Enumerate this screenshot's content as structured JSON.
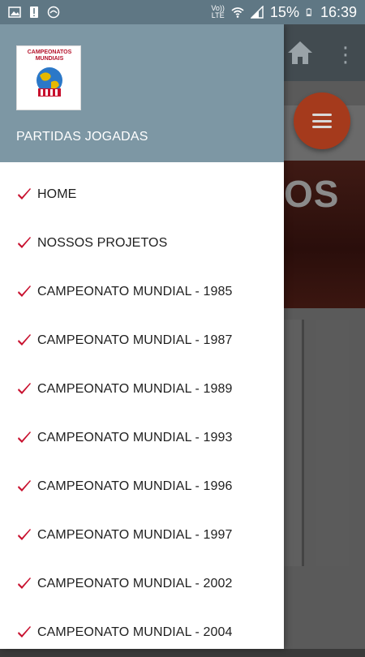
{
  "status_bar": {
    "network_label_top": "Vo))",
    "network_label_bottom": "LTE",
    "battery_percent": "15%",
    "time": "16:39"
  },
  "background_app": {
    "banner_text": "OS"
  },
  "drawer": {
    "logo": {
      "title_line1": "CAMPEONATOS",
      "title_line2": "MUNDIAIS"
    },
    "header_title": "PARTIDAS JOGADAS",
    "items": [
      {
        "label": "HOME"
      },
      {
        "label": "NOSSOS PROJETOS"
      },
      {
        "label": "CAMPEONATO MUNDIAL - 1985"
      },
      {
        "label": "CAMPEONATO MUNDIAL - 1987"
      },
      {
        "label": "CAMPEONATO MUNDIAL - 1989"
      },
      {
        "label": "CAMPEONATO MUNDIAL - 1993"
      },
      {
        "label": "CAMPEONATO MUNDIAL - 1996"
      },
      {
        "label": "CAMPEONATO MUNDIAL - 1997"
      },
      {
        "label": "CAMPEONATO MUNDIAL - 2002"
      },
      {
        "label": "CAMPEONATO MUNDIAL - 2004"
      }
    ]
  },
  "colors": {
    "status_bar": "#5f7784",
    "drawer_header": "#7d97a4",
    "check_accent": "#c8102e",
    "fab": "#a53a1c"
  }
}
